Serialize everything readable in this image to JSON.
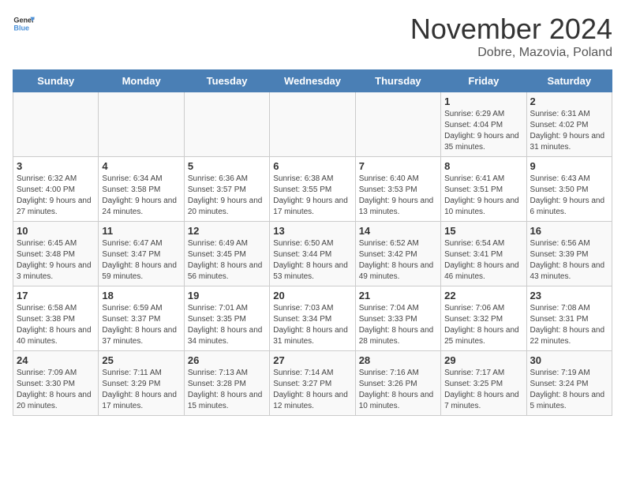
{
  "header": {
    "logo_general": "General",
    "logo_blue": "Blue",
    "month": "November 2024",
    "location": "Dobre, Mazovia, Poland"
  },
  "weekdays": [
    "Sunday",
    "Monday",
    "Tuesday",
    "Wednesday",
    "Thursday",
    "Friday",
    "Saturday"
  ],
  "weeks": [
    [
      {
        "day": "",
        "info": ""
      },
      {
        "day": "",
        "info": ""
      },
      {
        "day": "",
        "info": ""
      },
      {
        "day": "",
        "info": ""
      },
      {
        "day": "",
        "info": ""
      },
      {
        "day": "1",
        "info": "Sunrise: 6:29 AM\nSunset: 4:04 PM\nDaylight: 9 hours and 35 minutes."
      },
      {
        "day": "2",
        "info": "Sunrise: 6:31 AM\nSunset: 4:02 PM\nDaylight: 9 hours and 31 minutes."
      }
    ],
    [
      {
        "day": "3",
        "info": "Sunrise: 6:32 AM\nSunset: 4:00 PM\nDaylight: 9 hours and 27 minutes."
      },
      {
        "day": "4",
        "info": "Sunrise: 6:34 AM\nSunset: 3:58 PM\nDaylight: 9 hours and 24 minutes."
      },
      {
        "day": "5",
        "info": "Sunrise: 6:36 AM\nSunset: 3:57 PM\nDaylight: 9 hours and 20 minutes."
      },
      {
        "day": "6",
        "info": "Sunrise: 6:38 AM\nSunset: 3:55 PM\nDaylight: 9 hours and 17 minutes."
      },
      {
        "day": "7",
        "info": "Sunrise: 6:40 AM\nSunset: 3:53 PM\nDaylight: 9 hours and 13 minutes."
      },
      {
        "day": "8",
        "info": "Sunrise: 6:41 AM\nSunset: 3:51 PM\nDaylight: 9 hours and 10 minutes."
      },
      {
        "day": "9",
        "info": "Sunrise: 6:43 AM\nSunset: 3:50 PM\nDaylight: 9 hours and 6 minutes."
      }
    ],
    [
      {
        "day": "10",
        "info": "Sunrise: 6:45 AM\nSunset: 3:48 PM\nDaylight: 9 hours and 3 minutes."
      },
      {
        "day": "11",
        "info": "Sunrise: 6:47 AM\nSunset: 3:47 PM\nDaylight: 8 hours and 59 minutes."
      },
      {
        "day": "12",
        "info": "Sunrise: 6:49 AM\nSunset: 3:45 PM\nDaylight: 8 hours and 56 minutes."
      },
      {
        "day": "13",
        "info": "Sunrise: 6:50 AM\nSunset: 3:44 PM\nDaylight: 8 hours and 53 minutes."
      },
      {
        "day": "14",
        "info": "Sunrise: 6:52 AM\nSunset: 3:42 PM\nDaylight: 8 hours and 49 minutes."
      },
      {
        "day": "15",
        "info": "Sunrise: 6:54 AM\nSunset: 3:41 PM\nDaylight: 8 hours and 46 minutes."
      },
      {
        "day": "16",
        "info": "Sunrise: 6:56 AM\nSunset: 3:39 PM\nDaylight: 8 hours and 43 minutes."
      }
    ],
    [
      {
        "day": "17",
        "info": "Sunrise: 6:58 AM\nSunset: 3:38 PM\nDaylight: 8 hours and 40 minutes."
      },
      {
        "day": "18",
        "info": "Sunrise: 6:59 AM\nSunset: 3:37 PM\nDaylight: 8 hours and 37 minutes."
      },
      {
        "day": "19",
        "info": "Sunrise: 7:01 AM\nSunset: 3:35 PM\nDaylight: 8 hours and 34 minutes."
      },
      {
        "day": "20",
        "info": "Sunrise: 7:03 AM\nSunset: 3:34 PM\nDaylight: 8 hours and 31 minutes."
      },
      {
        "day": "21",
        "info": "Sunrise: 7:04 AM\nSunset: 3:33 PM\nDaylight: 8 hours and 28 minutes."
      },
      {
        "day": "22",
        "info": "Sunrise: 7:06 AM\nSunset: 3:32 PM\nDaylight: 8 hours and 25 minutes."
      },
      {
        "day": "23",
        "info": "Sunrise: 7:08 AM\nSunset: 3:31 PM\nDaylight: 8 hours and 22 minutes."
      }
    ],
    [
      {
        "day": "24",
        "info": "Sunrise: 7:09 AM\nSunset: 3:30 PM\nDaylight: 8 hours and 20 minutes."
      },
      {
        "day": "25",
        "info": "Sunrise: 7:11 AM\nSunset: 3:29 PM\nDaylight: 8 hours and 17 minutes."
      },
      {
        "day": "26",
        "info": "Sunrise: 7:13 AM\nSunset: 3:28 PM\nDaylight: 8 hours and 15 minutes."
      },
      {
        "day": "27",
        "info": "Sunrise: 7:14 AM\nSunset: 3:27 PM\nDaylight: 8 hours and 12 minutes."
      },
      {
        "day": "28",
        "info": "Sunrise: 7:16 AM\nSunset: 3:26 PM\nDaylight: 8 hours and 10 minutes."
      },
      {
        "day": "29",
        "info": "Sunrise: 7:17 AM\nSunset: 3:25 PM\nDaylight: 8 hours and 7 minutes."
      },
      {
        "day": "30",
        "info": "Sunrise: 7:19 AM\nSunset: 3:24 PM\nDaylight: 8 hours and 5 minutes."
      }
    ]
  ]
}
